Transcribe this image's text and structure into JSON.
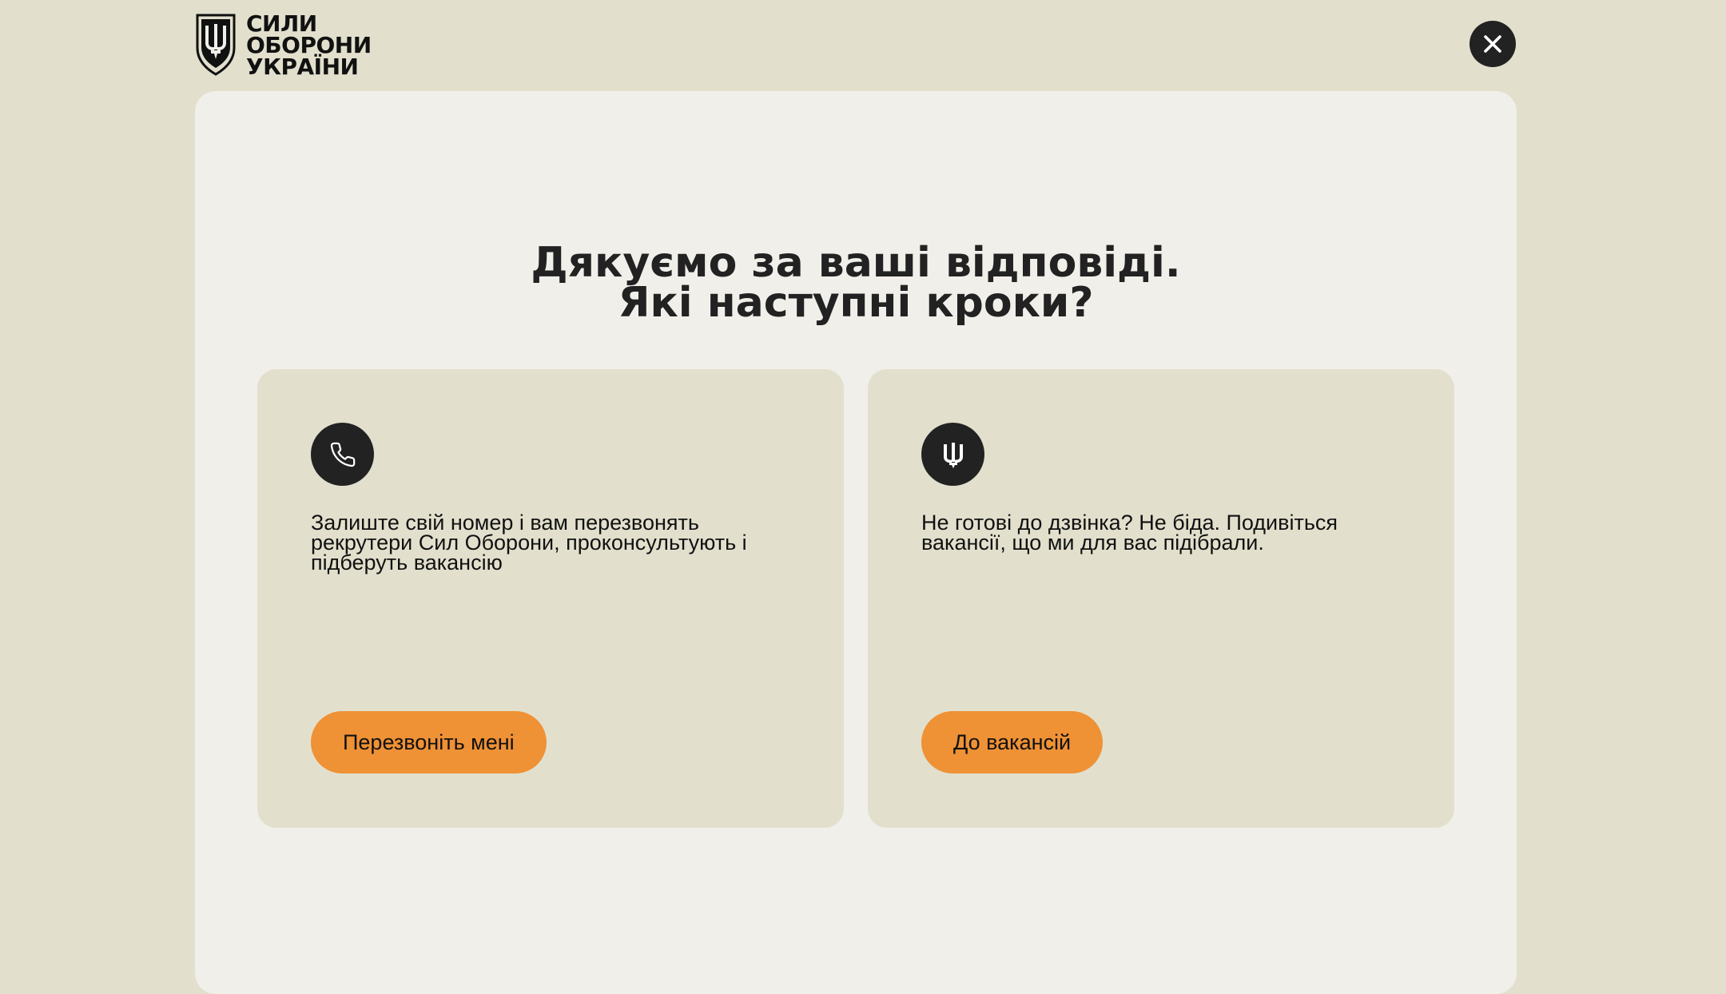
{
  "header": {
    "logo_lines": [
      "СИЛИ",
      "ОБОРОНИ",
      "УКРАЇНИ"
    ],
    "logo_icon": "trident-shield-icon",
    "close_icon": "close-icon"
  },
  "main": {
    "heading_line1": "Дякуємо за ваші відповіді.",
    "heading_line2": "Які наступні кроки?",
    "cards": [
      {
        "icon": "phone-icon",
        "text": "Залиште свій номер і вам перезвонять рекрутери Сил Оборони, проконсультують і підберуть вакансію",
        "button_label": "Перезвоніть мені"
      },
      {
        "icon": "trident-icon",
        "text": "Не готові до дзвінка? Не біда. Подивіться вакансії, що ми для вас підібрали.",
        "button_label": "До вакансій"
      }
    ]
  },
  "colors": {
    "page_background": "#e2e0cd",
    "panel_background": "#f1efe9",
    "card_background": "#e2e0cd",
    "accent_button": "#ef9135",
    "dark": "#222222"
  }
}
